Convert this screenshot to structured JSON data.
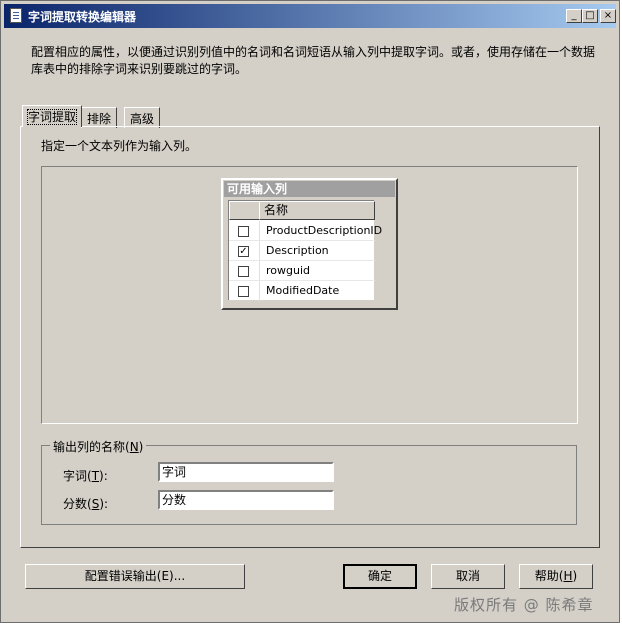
{
  "window": {
    "title": "字词提取转换编辑器",
    "controls": {
      "minimize": "_",
      "maximize": "□",
      "close": "×"
    }
  },
  "description": "配置相应的属性，以便通过识别列值中的名词和名词短语从输入列中提取字词。或者，使用存储在一个数据库表中的排除字词来识别要跳过的字词。",
  "tabs": [
    {
      "label": "字词提取",
      "active": true
    },
    {
      "label": "排除",
      "active": false
    },
    {
      "label": "高级",
      "active": false
    }
  ],
  "instruction": "指定一个文本列作为输入列。",
  "input_columns": {
    "header": "可用输入列",
    "column_header": "名称",
    "rows": [
      {
        "name": "ProductDescriptionID",
        "checked": false
      },
      {
        "name": "Description",
        "checked": true
      },
      {
        "name": "rowguid",
        "checked": false
      },
      {
        "name": "ModifiedDate",
        "checked": false
      }
    ]
  },
  "output": {
    "group_label_prefix": "输出列的名称(",
    "group_label_key": "N",
    "group_label_suffix": ")",
    "term_label_prefix": "字词(",
    "term_label_key": "T",
    "term_label_suffix": "):",
    "term_value": "字词",
    "score_label_prefix": "分数(",
    "score_label_key": "S",
    "score_label_suffix": "):",
    "score_value": "分数"
  },
  "buttons": {
    "configure_error_output": "配置错误输出(E)...",
    "ok": "确定",
    "cancel": "取消",
    "help_prefix": "帮助(",
    "help_key": "H",
    "help_suffix": ")"
  },
  "watermark": "版权所有 @ 陈希章"
}
